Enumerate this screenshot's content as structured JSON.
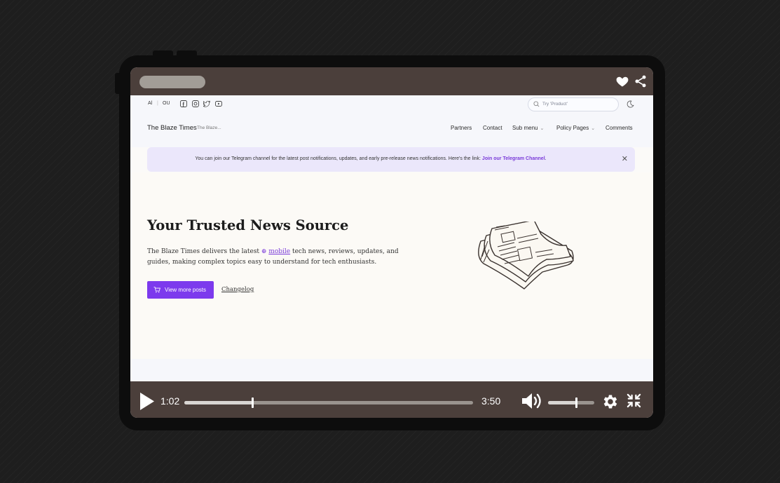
{
  "utility_bar": {
    "lang_1": "Al",
    "lang_2": "OU",
    "search_placeholder": "Try 'Product'"
  },
  "nav": {
    "brand": "The Blaze Times",
    "brand_sub": "The Blaze...",
    "items": [
      "Partners",
      "Contact",
      "Sub menu",
      "Policy Pages",
      "Comments"
    ]
  },
  "banner": {
    "text": "You can join our Telegram channel for the latest post notifications, updates, and early pre-release news notifications. Here's the link: ",
    "link": "Join our Telegram Channel",
    "after": "."
  },
  "hero": {
    "title": "Your Trusted News Source",
    "desc_before": "The Blaze Times delivers the latest ",
    "desc_highlight": "mobile",
    "desc_after": " tech news, reviews, updates, and guides, making complex topics easy to understand for tech enthusiasts.",
    "cta_label": "View more posts",
    "secondary_link": "Changelog"
  },
  "player": {
    "current_time": "1:02",
    "total_time": "3:50",
    "progress": 0.235,
    "volume": 0.6
  },
  "colors": {
    "accent": "#7c3aed",
    "frame_bar": "#4b3f3b",
    "banner_bg": "#ebe7fb"
  },
  "icons": [
    "heart-icon",
    "share-icon",
    "facebook-icon",
    "instagram-icon",
    "twitter-icon",
    "youtube-icon",
    "search-icon",
    "theme-toggle-icon",
    "close-icon",
    "cart-icon",
    "newspaper-illustration",
    "play-icon",
    "volume-icon",
    "settings-icon",
    "exit-fullscreen-icon"
  ]
}
